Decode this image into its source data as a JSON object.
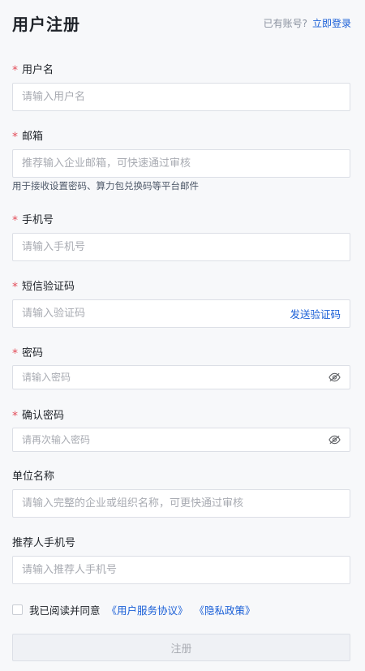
{
  "header": {
    "title": "用户注册",
    "have_account": "已有账号?",
    "login_link": "立即登录"
  },
  "required_mark": "*",
  "fields": {
    "username": {
      "label": "用户名",
      "placeholder": "请输入用户名",
      "required": true
    },
    "email": {
      "label": "邮箱",
      "placeholder": "推荐输入企业邮箱，可快速通过审核",
      "hint": "用于接收设置密码、算力包兑换码等平台邮件",
      "required": true
    },
    "phone": {
      "label": "手机号",
      "placeholder": "请输入手机号",
      "required": true
    },
    "sms_code": {
      "label": "短信验证码",
      "placeholder": "请输入验证码",
      "send_label": "发送验证码",
      "required": true
    },
    "password": {
      "label": "密码",
      "placeholder": "请输入密码",
      "required": true
    },
    "confirm_password": {
      "label": "确认密码",
      "placeholder": "请再次输入密码",
      "required": true
    },
    "organization": {
      "label": "单位名称",
      "placeholder": "请输入完整的企业或组织名称，可更快通过审核",
      "required": false
    },
    "referrer_phone": {
      "label": "推荐人手机号",
      "placeholder": "请输入推荐人手机号",
      "required": false
    }
  },
  "agreement": {
    "text": "我已阅读并同意",
    "user_agreement": "《用户服务协议》",
    "privacy_policy": "《隐私政策》",
    "checked": false
  },
  "submit_label": "注册",
  "colors": {
    "accent": "#1a5fd7",
    "required": "#e34d59",
    "placeholder": "#a8abb2",
    "border": "#dcdfe6"
  },
  "icons": {
    "password_toggle": "eye-off-icon"
  }
}
